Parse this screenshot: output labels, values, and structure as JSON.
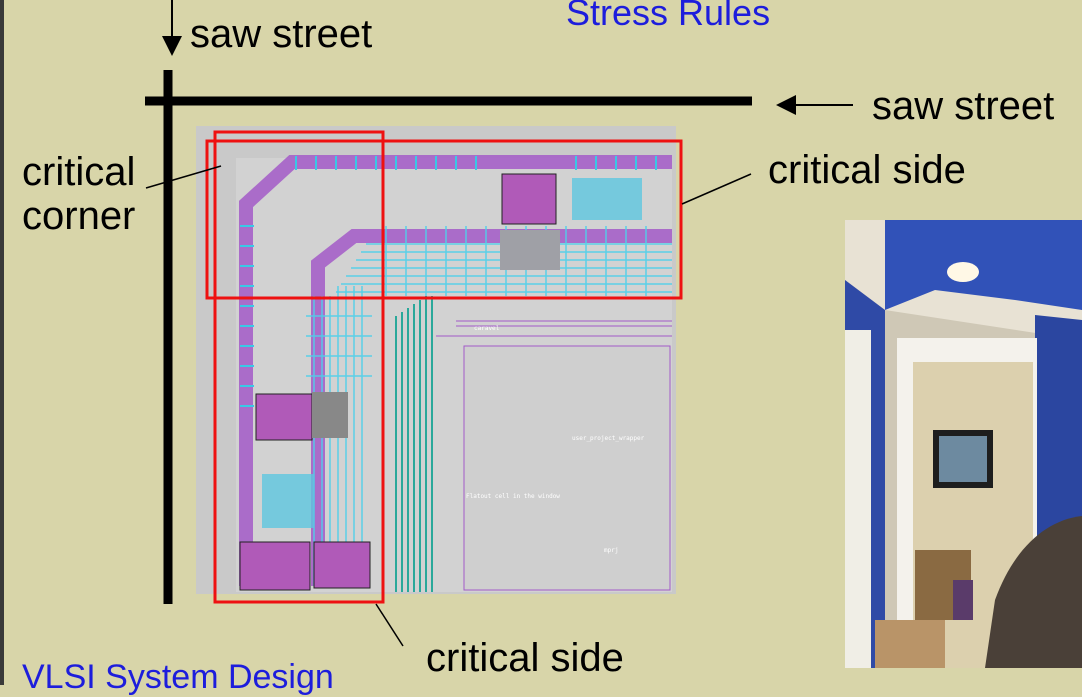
{
  "slide": {
    "title": "Stress Rules",
    "footer": "VLSI System Design",
    "colors": {
      "background": "#d8d5a9",
      "title": "#1d1ddc",
      "highlight": "#ee1111"
    }
  },
  "labels": {
    "saw_street_top": "saw street",
    "saw_street_right": "saw street",
    "critical_corner_line1": "critical",
    "critical_corner_line2": "corner",
    "critical_side_right": "critical side",
    "critical_side_bottom": "critical side"
  },
  "layout_view": {
    "tiny_labels": [
      "user_project_wrapper",
      "Flatout cell in the window",
      "mprj",
      "caravel"
    ]
  },
  "webcam": {
    "subject": "presenter webcam feed"
  }
}
